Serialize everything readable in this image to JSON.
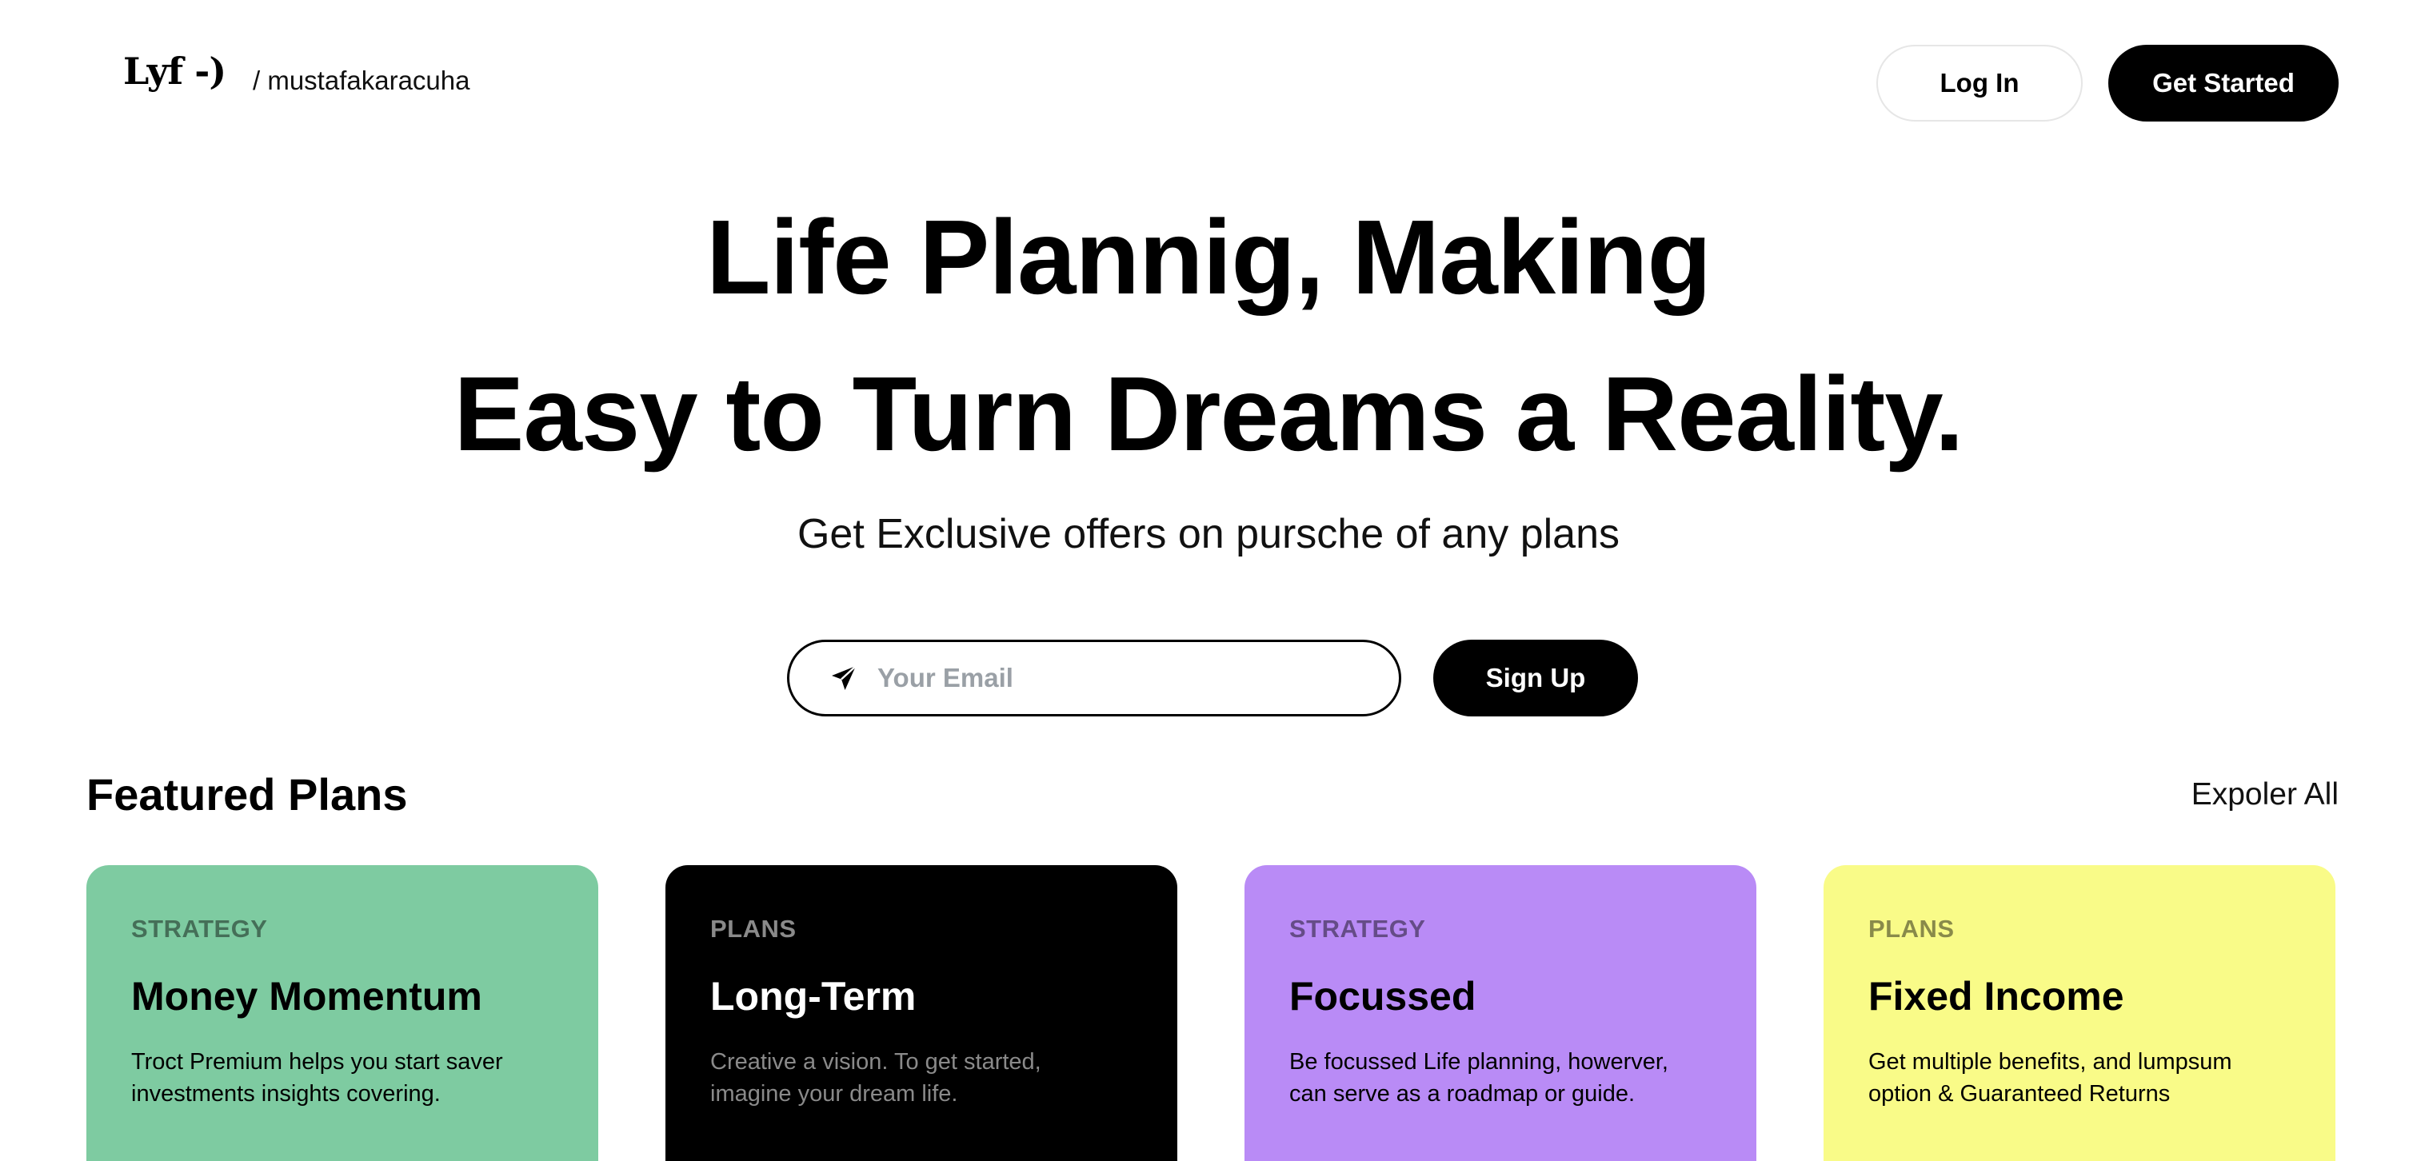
{
  "header": {
    "logo_text": "Lyf -)",
    "breadcrumb": "/ mustafakaracuha",
    "login_label": "Log In",
    "get_started_label": "Get Started"
  },
  "hero": {
    "title_line1": "Life Plannig, Making",
    "title_line2": "Easy to Turn Dreams a Reality.",
    "subtitle": "Get Exclusive offers on pursche of any plans"
  },
  "signup": {
    "email_placeholder": "Your Email",
    "email_value": "",
    "send_icon": "send-icon",
    "button_label": "Sign Up"
  },
  "featured": {
    "title": "Featured Plans",
    "explore_label": "Expoler All",
    "cards": [
      {
        "tag": "STRATEGY",
        "title": "Money Momentum",
        "description": "Troct Premium helps you start saver investments insights covering.",
        "background": "#7ecba1"
      },
      {
        "tag": "PLANS",
        "title": "Long-Term",
        "description": "Creative a vision. To get started, imagine your dream life.",
        "background": "#000000"
      },
      {
        "tag": "STRATEGY",
        "title": "Focussed",
        "description": "Be focussed Life planning, howerver, can serve as a roadmap or guide.",
        "background": "#b98bf6"
      },
      {
        "tag": "PLANS",
        "title": "Fixed Income",
        "description": "Get multiple benefits, and lumpsum option & Guaranteed Returns",
        "background": "#f9fb88"
      }
    ]
  },
  "colors": {
    "primary_button": "#000000",
    "primary_button_text": "#ffffff",
    "placeholder": "#9aa0a6"
  }
}
